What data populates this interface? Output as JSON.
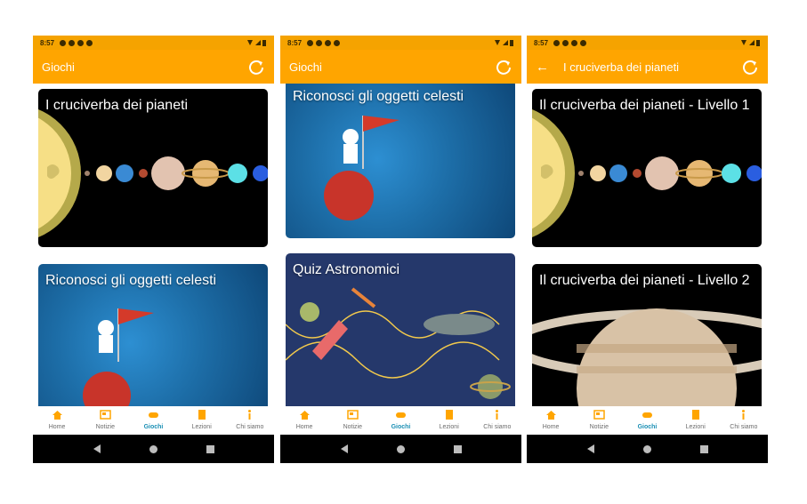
{
  "phones": [
    {
      "status": {
        "time": "8:57"
      },
      "appbar": {
        "title": "Giochi"
      },
      "cards": [
        {
          "title": "I cruciverba dei pianeti"
        },
        {
          "title": "Riconosci gli oggetti celesti"
        }
      ]
    },
    {
      "status": {
        "time": "8:57"
      },
      "appbar": {
        "title": "Giochi"
      },
      "cards": [
        {
          "title": "Riconosci gli oggetti celesti"
        },
        {
          "title": "Quiz Astronomici"
        }
      ]
    },
    {
      "status": {
        "time": "8:57"
      },
      "appbar": {
        "title": "I cruciverba dei pianeti"
      },
      "cards": [
        {
          "title": "Il cruciverba dei pianeti - Livello 1"
        },
        {
          "title": "Il cruciverba dei pianeti - Livello 2"
        }
      ]
    }
  ],
  "nav": {
    "items": [
      "Home",
      "Notizie",
      "Giochi",
      "Lezioni",
      "Chi siamo"
    ],
    "active": "Giochi",
    "icons": [
      "home-icon",
      "news-icon",
      "gamepad-icon",
      "book-icon",
      "info-icon"
    ]
  },
  "colors": {
    "accent": "#ffa500",
    "active": "#1a8fb4"
  }
}
